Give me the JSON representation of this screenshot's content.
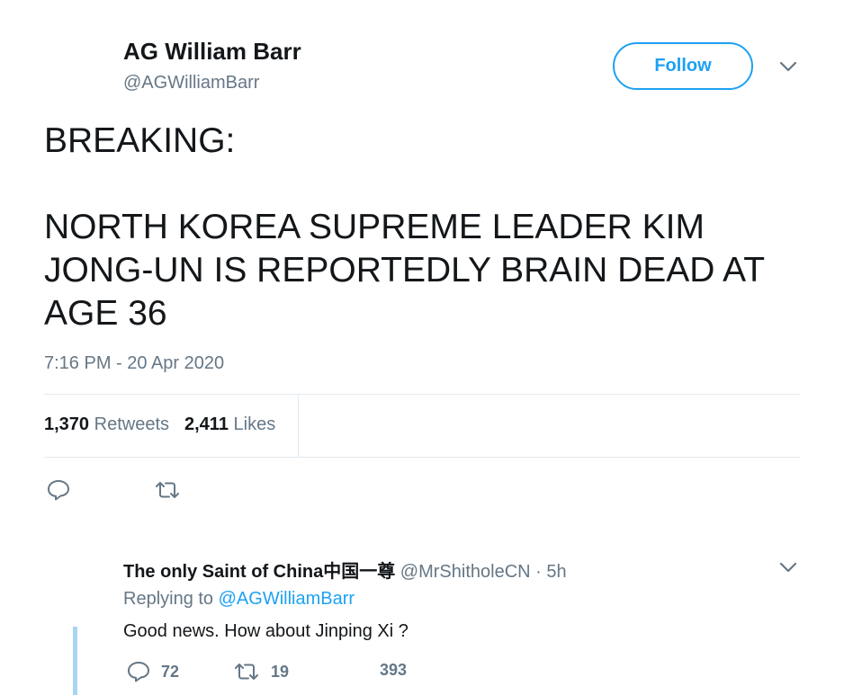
{
  "tweet": {
    "display_name": "AG William Barr",
    "handle": "@AGWilliamBarr",
    "follow_label": "Follow",
    "text_line1": "BREAKING:",
    "text_line2": "NORTH KOREA SUPREME LEADER KIM JONG-UN IS REPORTEDLY BRAIN DEAD AT AGE 36",
    "timestamp": "7:16 PM - 20 Apr 2020",
    "retweets_count": "1,370",
    "retweets_label": "Retweets",
    "likes_count": "2,411",
    "likes_label": "Likes",
    "icons": [
      "chevron-down-icon",
      "reply-icon",
      "retweet-icon"
    ]
  },
  "reply": {
    "display_name": "The only Saint of China中国一尊",
    "handle": "@MrShitholeCN",
    "separator": "·",
    "time": "5h",
    "replying_prefix": "Replying to",
    "replying_to": "@AGWilliamBarr",
    "text": "Good news. How about Jinping Xi ?",
    "reply_count": "72",
    "retweet_count": "19",
    "like_count": "393"
  },
  "colors": {
    "accent": "#1da1f2",
    "muted": "#657786",
    "text": "#14171a",
    "divider": "#e1e8ed",
    "thread_line": "#a8d5f2"
  }
}
